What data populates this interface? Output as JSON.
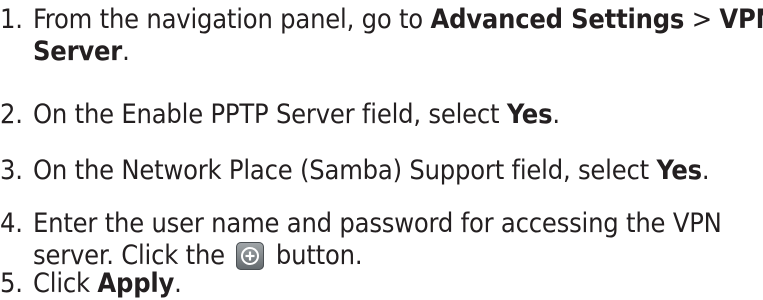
{
  "steps": [
    {
      "number": "1.",
      "line1_prefix": "From the navigation panel, go to ",
      "line1_bold": "Advanced Settings",
      "line1_sep": " > ",
      "line1_bold2": "VPN",
      "line2_bold": "Server",
      "line2_suffix": "."
    },
    {
      "number": "2.",
      "prefix": "On the Enable PPTP Server field, select ",
      "bold": "Yes",
      "suffix": "."
    },
    {
      "number": "3.",
      "prefix": "On the Network Place (Samba) Support field, select ",
      "bold": "Yes",
      "suffix": "."
    },
    {
      "number": "4.",
      "line1": "Enter the user name and password for accessing the VPN",
      "line2_prefix": "server. Click the ",
      "line2_suffix": " button.",
      "icon": "add-circle-icon"
    },
    {
      "number": "5.",
      "prefix": "Click ",
      "bold": "Apply",
      "suffix": "."
    }
  ]
}
